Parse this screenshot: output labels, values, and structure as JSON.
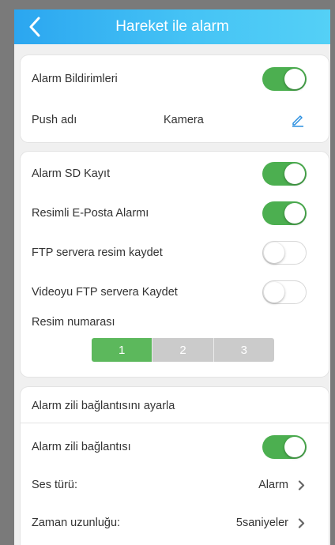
{
  "header": {
    "title": "Hareket ile alarm"
  },
  "card1": {
    "alarm_notifications": {
      "label": "Alarm Bildirimleri",
      "on": true
    },
    "push_name": {
      "label": "Push adı",
      "value": "Kamera"
    }
  },
  "card2": {
    "sd_record": {
      "label": "Alarm SD Kayıt",
      "on": true
    },
    "email_alarm": {
      "label": "Resimli E-Posta Alarmı",
      "on": true
    },
    "ftp_image": {
      "label": "FTP servera resim kaydet",
      "on": false
    },
    "ftp_video": {
      "label": "Videoyu FTP servera Kaydet",
      "on": false
    },
    "picture_count": {
      "label": "Resim numarası",
      "options": [
        "1",
        "2",
        "3"
      ],
      "selected": "1"
    }
  },
  "card3": {
    "section_title": "Alarm zili bağlantısını ayarla",
    "bell_link": {
      "label": "Alarm zili bağlantısı",
      "on": true
    },
    "sound_type": {
      "label": "Ses türü:",
      "value": "Alarm"
    },
    "duration": {
      "label": "Zaman uzunluğu:",
      "value": "5saniyeler"
    }
  },
  "colors": {
    "header_start": "#2ba6f0",
    "header_end": "#54d0f6",
    "toggle_on": "#4caf50",
    "segment_active": "#5cb85c",
    "segment_inactive": "#cbcbcb",
    "edit_icon": "#2b8fe0"
  }
}
